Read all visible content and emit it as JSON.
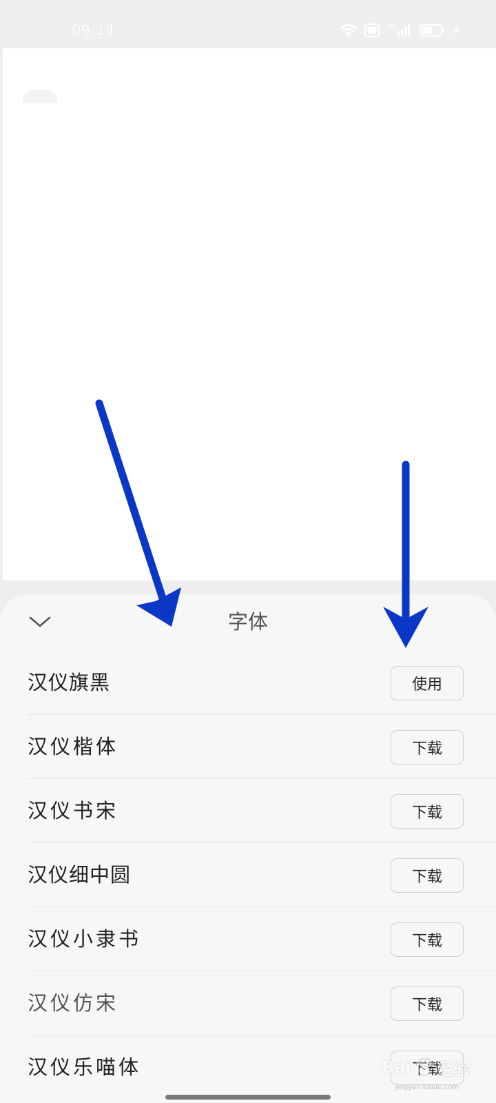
{
  "status_bar": {
    "time": "09:14",
    "icons": [
      "wifi-icon",
      "hd-icon",
      "signal-icon",
      "battery-icon",
      "charging-icon"
    ],
    "signal_label": "4G"
  },
  "sheet": {
    "title": "字体",
    "collapse_icon": "chevron-down-icon",
    "fonts": [
      {
        "name": "汉仪旗黑",
        "action": "使用"
      },
      {
        "name": "汉仪楷体",
        "action": "下载"
      },
      {
        "name": "汉仪书宋",
        "action": "下载"
      },
      {
        "name": "汉仪细中圆",
        "action": "下载"
      },
      {
        "name": "汉仪小隶书",
        "action": "下载"
      },
      {
        "name": "汉仪仿宋",
        "action": "下载"
      },
      {
        "name": "汉仪乐喵体",
        "action": "下载"
      }
    ]
  },
  "annotations": {
    "arrow_color": "#0a37c6"
  },
  "watermark": {
    "text": "Bai",
    "text2": "经验",
    "sub": "jingyan.baidu.com"
  },
  "colors": {
    "sheet_background": "#f7f7f7",
    "canvas_background": "#ffffff",
    "button_border": "#cfcfcf"
  }
}
